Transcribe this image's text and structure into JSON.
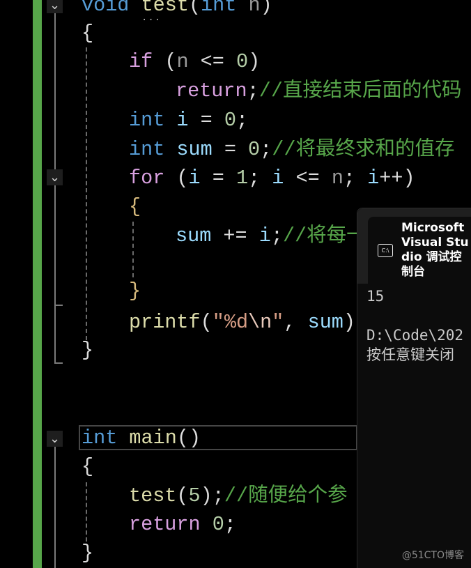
{
  "code": {
    "l0": {
      "a": "void",
      "b": " ",
      "c": "test",
      "d": "(",
      "e": "int",
      "f": " ",
      "g": "n",
      "h": ")"
    },
    "l1": "{",
    "l2": {
      "a": "if",
      "b": " (",
      "c": "n",
      "d": " <= ",
      "e": "0",
      "f": ")"
    },
    "l3": {
      "a": "return",
      "b": ";",
      "c": "//直接结束后面的代码"
    },
    "l4": {
      "a": "int",
      "b": " ",
      "c": "i",
      "d": " = ",
      "e": "0",
      "f": ";"
    },
    "l5": {
      "a": "int",
      "b": " ",
      "c": "sum",
      "d": " = ",
      "e": "0",
      "f": ";",
      "g": "//将最终求和的值存"
    },
    "l6": {
      "a": "for",
      "b": " (",
      "c": "i",
      "d": " = ",
      "e": "1",
      "f": "; ",
      "g": "i",
      "h": " <= ",
      "i": "n",
      "j": "; ",
      "k": "i",
      "l": "++)"
    },
    "l7": "{",
    "l8": {
      "a": "sum",
      "b": " += ",
      "c": "i",
      "d": ";",
      "e": "//将每一"
    },
    "l10": "}",
    "l11": {
      "a": "printf",
      "b": "(",
      "c": "\"%d",
      "d": "\\n",
      "e": "\"",
      "f": ", ",
      "g": "sum",
      "h": ");"
    },
    "l12": "}",
    "l15": {
      "a": "int",
      "b": " ",
      "c": "main",
      "d": "()"
    },
    "l16": "{",
    "l17": {
      "a": "test",
      "b": "(",
      "c": "5",
      "d": ");",
      "e": "//随便给个参"
    },
    "l18": {
      "a": "return",
      "b": " ",
      "c": "0",
      "d": ";"
    },
    "l19": "}"
  },
  "editor": {
    "hint_dots": "..."
  },
  "console": {
    "tab_title": "Microsoft Visual Studio 调试控制台",
    "icon_text": "C:\\",
    "output": [
      "15",
      "",
      "D:\\Code\\202",
      "按任意键关闭"
    ]
  },
  "watermark": "@51CTO博客"
}
